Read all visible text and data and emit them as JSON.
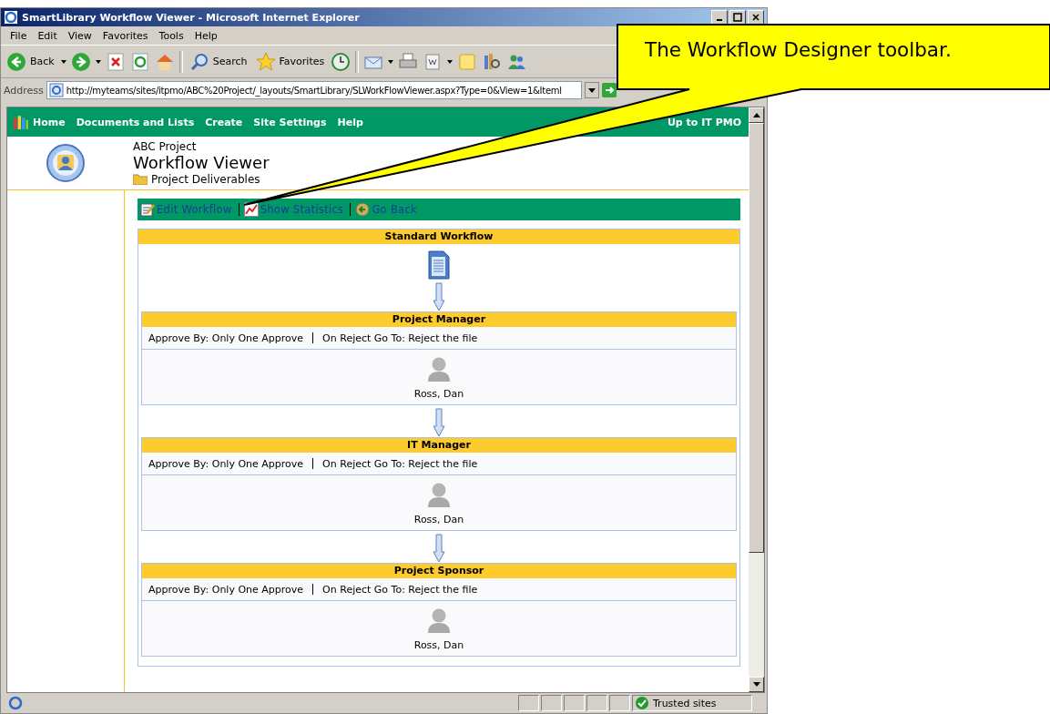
{
  "window": {
    "title": "SmartLibrary Workflow Viewer - Microsoft Internet Explorer"
  },
  "menu": [
    "File",
    "Edit",
    "View",
    "Favorites",
    "Tools",
    "Help"
  ],
  "toolbar": {
    "back": "Back",
    "search": "Search",
    "favorites": "Favorites"
  },
  "address": {
    "label": "Address",
    "url": "http://myteams/sites/itpmo/ABC%20Project/_layouts/SmartLibrary/SLWorkFlowViewer.aspx?Type=0&View=1&Iteml"
  },
  "nav": {
    "links": [
      "Home",
      "Documents and Lists",
      "Create",
      "Site Settings",
      "Help"
    ],
    "right": "Up to IT PMO"
  },
  "header": {
    "site": "ABC Project",
    "title": "Workflow Viewer",
    "breadcrumb": "Project Deliverables"
  },
  "actions": [
    "Edit Workflow",
    "Show Statistics",
    "Go Back"
  ],
  "workflow": {
    "title": "Standard Workflow",
    "steps": [
      {
        "name": "Project Manager",
        "approve_by": "Approve By: Only One Approve",
        "on_reject": "On Reject Go To: Reject the file",
        "people": [
          "Ross, Dan"
        ]
      },
      {
        "name": "IT Manager",
        "approve_by": "Approve By: Only One Approve",
        "on_reject": "On Reject Go To: Reject the file",
        "people": [
          "Ross, Dan"
        ]
      },
      {
        "name": "Project Sponsor",
        "approve_by": "Approve By: Only One Approve",
        "on_reject": "On Reject Go To: Reject the file",
        "people": [
          "Ross, Dan"
        ]
      }
    ]
  },
  "status_bar": {
    "zone": "Trusted sites"
  },
  "callout": {
    "text": "The Workflow Designer toolbar."
  }
}
